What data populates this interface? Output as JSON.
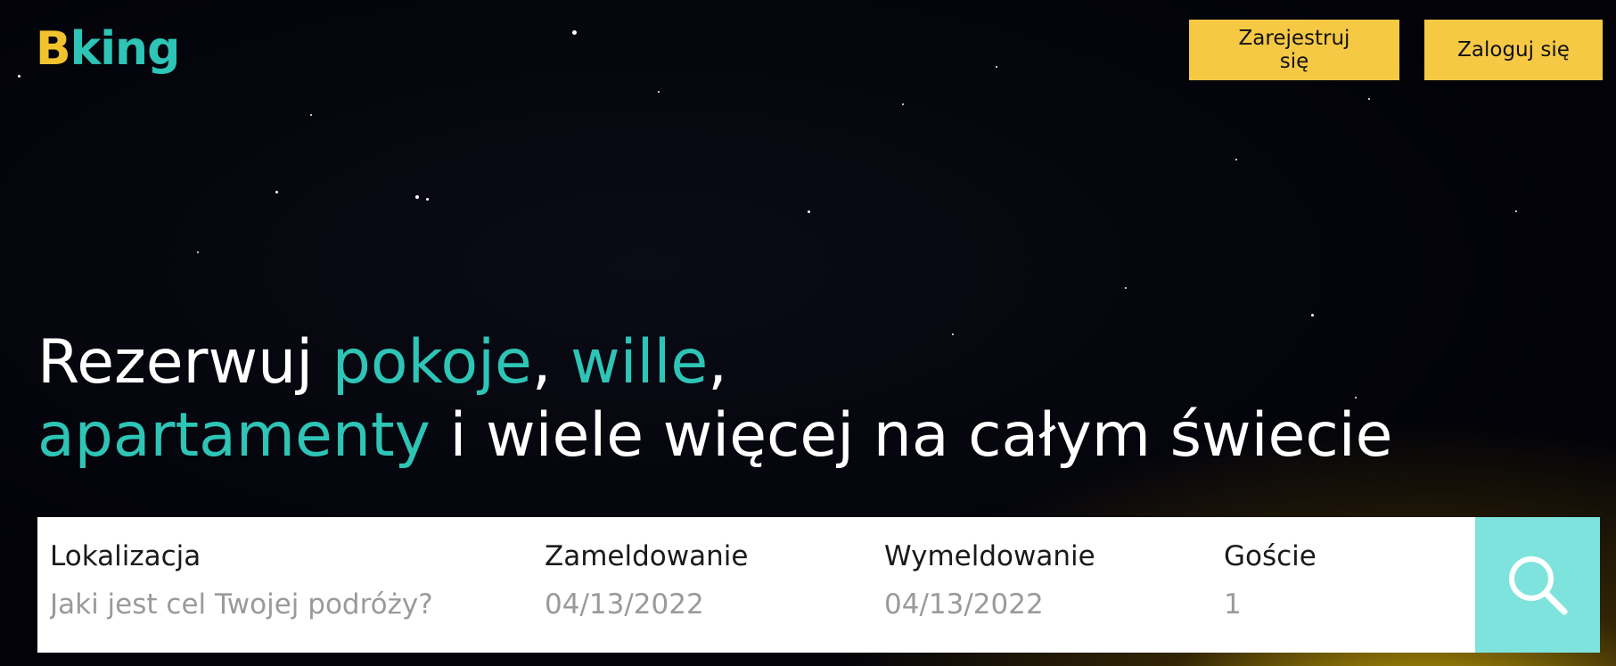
{
  "logo": {
    "first_letter": "B",
    "rest": "king"
  },
  "auth": {
    "register_label": "Zarejestruj się",
    "login_label": "Zaloguj się"
  },
  "headline": {
    "part1": "Rezerwuj ",
    "accent1": "pokoje",
    "sep1": ", ",
    "accent2": "wille",
    "sep2": ",",
    "accent3": "apartamenty",
    "part2": " i wiele więcej na całym świecie"
  },
  "search": {
    "location": {
      "label": "Lokalizacja",
      "placeholder": "Jaki jest cel Twojej podróży?"
    },
    "checkin": {
      "label": "Zameldowanie",
      "value": "04/13/2022"
    },
    "checkout": {
      "label": "Wymeldowanie",
      "value": "04/13/2022"
    },
    "guests": {
      "label": "Goście",
      "value": "1"
    },
    "button_icon": "search-icon"
  },
  "colors": {
    "accent_teal": "#2ec4b6",
    "logo_yellow": "#f2c12e",
    "button_yellow": "#f6c945",
    "search_button": "#7fe3dd"
  }
}
